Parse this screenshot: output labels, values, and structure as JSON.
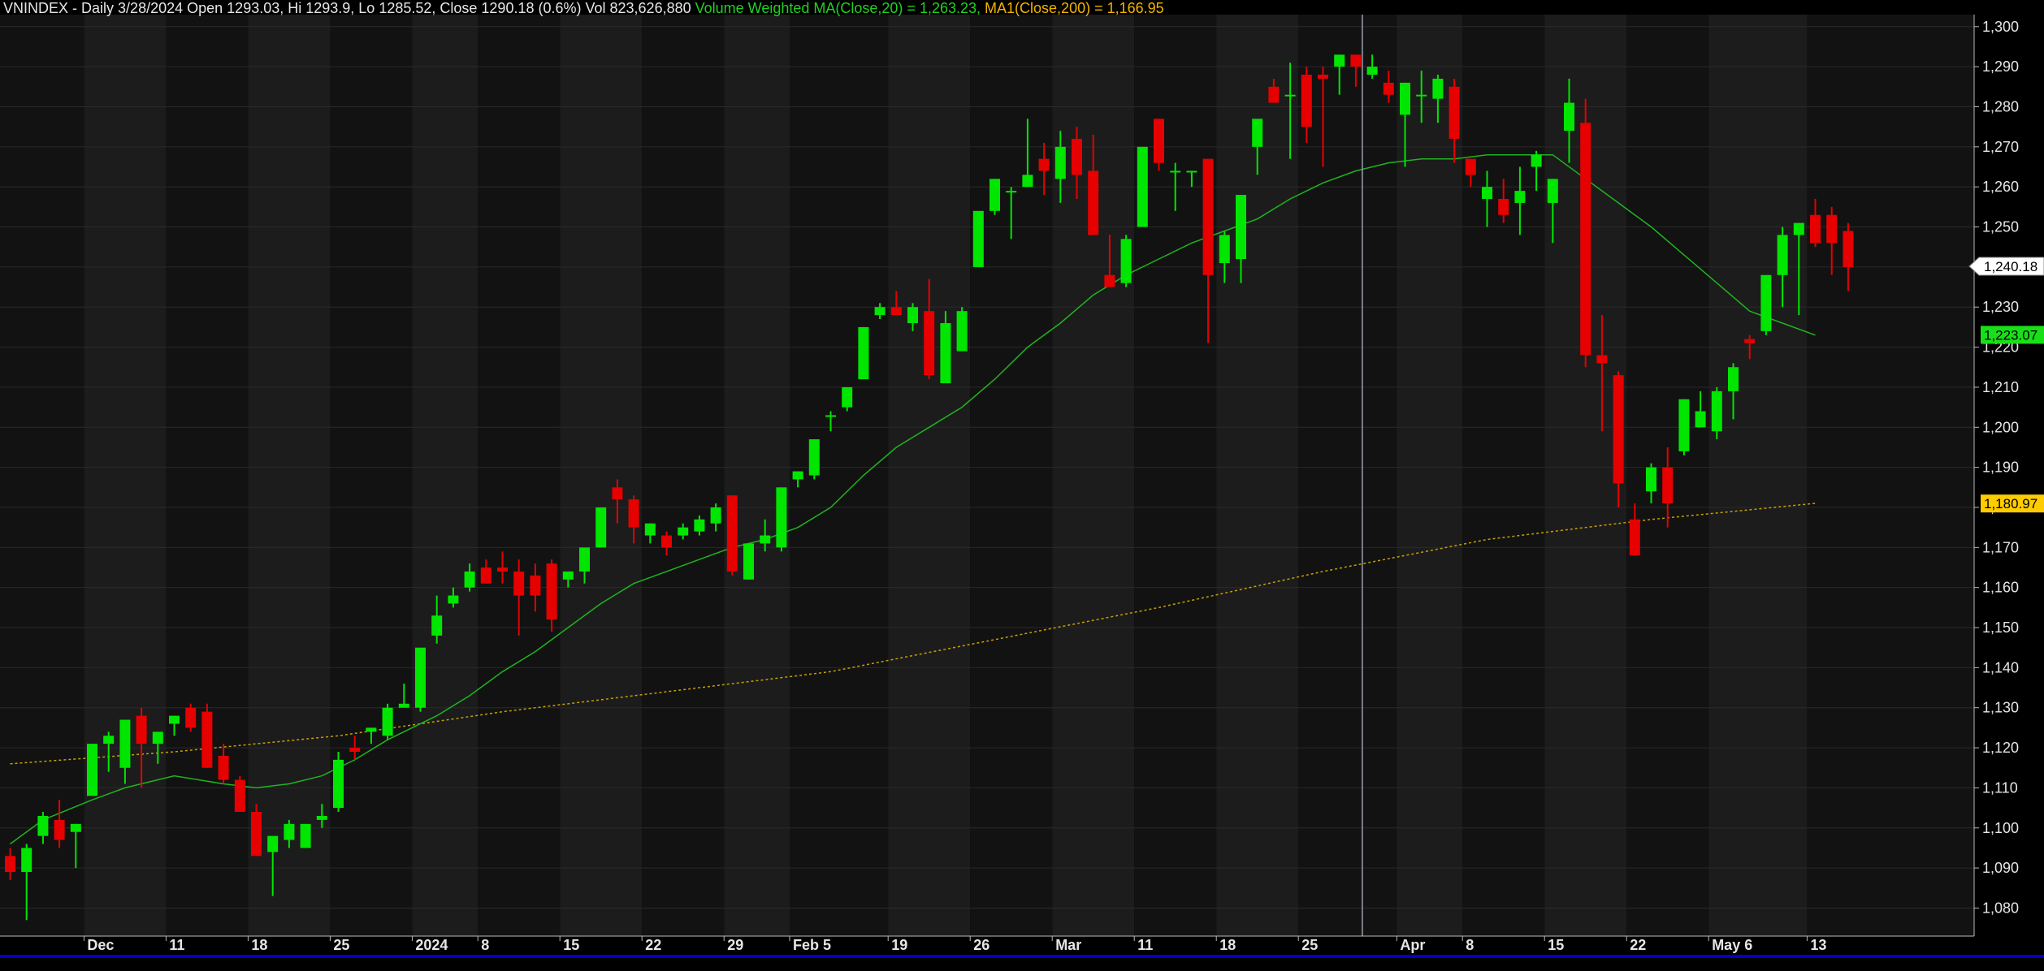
{
  "header": {
    "symbol": "VNINDEX",
    "period": "Daily",
    "date": "3/28/2024",
    "ohlcv_text": "Open 1293.03, Hi 1293.9, Lo 1285.52, Close 1290.18 (0.6%) Vol 823,626,880",
    "vwma_text": "Volume Weighted MA(Close,20) = 1,263.23,",
    "ma_text": "MA1(Close,200) = 1,166.95"
  },
  "colors": {
    "background": "#000000",
    "band_light": "#1c1c1c",
    "band_dark": "#121212",
    "up": "#00e600",
    "down": "#e60000",
    "vwma": "#1fb51f",
    "ma200": "#c8a000",
    "text": "#e6e6e6",
    "cursor": "#9aa0b0",
    "bottom_bar": "#0000c8"
  },
  "chart_data": {
    "type": "candlestick",
    "y_range": [
      1073,
      1303
    ],
    "y_ticks": [
      1080,
      1090,
      1100,
      1110,
      1120,
      1130,
      1140,
      1150,
      1160,
      1170,
      1180,
      1190,
      1200,
      1210,
      1220,
      1230,
      1240,
      1250,
      1260,
      1270,
      1280,
      1290,
      1300
    ],
    "y_tick_labels": [
      "1,080",
      "1,090",
      "1,100",
      "1,110",
      "1,120",
      "1,130",
      "1,140",
      "1,150",
      "1,160",
      "1,170",
      "1,180",
      "1,190",
      "1,200",
      "1,210",
      "1,220",
      "1,230",
      "1,240",
      "1,250",
      "1,260",
      "1,270",
      "1,280",
      "1,290",
      "1,300"
    ],
    "x_labels": [
      {
        "label": "Dec",
        "index": 5
      },
      {
        "label": "11",
        "index": 10
      },
      {
        "label": "18",
        "index": 15
      },
      {
        "label": "25",
        "index": 20
      },
      {
        "label": "2024",
        "index": 25
      },
      {
        "label": "8",
        "index": 29
      },
      {
        "label": "15",
        "index": 34
      },
      {
        "label": "22",
        "index": 39
      },
      {
        "label": "29",
        "index": 44
      },
      {
        "label": "Feb 5",
        "index": 48
      },
      {
        "label": "19",
        "index": 54
      },
      {
        "label": "26",
        "index": 59
      },
      {
        "label": "Mar",
        "index": 64
      },
      {
        "label": "11",
        "index": 69
      },
      {
        "label": "18",
        "index": 74
      },
      {
        "label": "25",
        "index": 79
      },
      {
        "label": "Apr",
        "index": 85
      },
      {
        "label": "8",
        "index": 89
      },
      {
        "label": "15",
        "index": 94
      },
      {
        "label": "22",
        "index": 99
      },
      {
        "label": "May 6",
        "index": 104
      },
      {
        "label": "13",
        "index": 110
      }
    ],
    "candles": [
      [
        1093,
        1095,
        1087,
        1089
      ],
      [
        1089,
        1096,
        1077,
        1095
      ],
      [
        1098,
        1104,
        1096,
        1103
      ],
      [
        1102,
        1107,
        1095,
        1097
      ],
      [
        1099,
        1101,
        1090,
        1101
      ],
      [
        1108,
        1115,
        1108,
        1121
      ],
      [
        1121,
        1124,
        1114,
        1123
      ],
      [
        1115,
        1127,
        1111,
        1127
      ],
      [
        1128,
        1130,
        1110,
        1121
      ],
      [
        1121,
        1123,
        1116,
        1124
      ],
      [
        1126,
        1128,
        1123,
        1128
      ],
      [
        1130,
        1131,
        1124,
        1125
      ],
      [
        1129,
        1131,
        1115,
        1115
      ],
      [
        1118,
        1121,
        1111,
        1112
      ],
      [
        1112,
        1113,
        1104,
        1104
      ],
      [
        1104,
        1106,
        1093,
        1093
      ],
      [
        1094,
        1097,
        1083,
        1098
      ],
      [
        1097,
        1102,
        1095,
        1101
      ],
      [
        1095,
        1098,
        1095,
        1101
      ],
      [
        1102,
        1106,
        1100,
        1103
      ],
      [
        1105,
        1119,
        1104,
        1117
      ],
      [
        1120,
        1123,
        1117,
        1119
      ],
      [
        1124,
        1125,
        1121,
        1125
      ],
      [
        1123,
        1131,
        1122,
        1130
      ],
      [
        1130,
        1136,
        1130,
        1131
      ],
      [
        1130,
        1143,
        1129,
        1145
      ],
      [
        1148,
        1158,
        1146,
        1153
      ],
      [
        1156,
        1160,
        1155,
        1158
      ],
      [
        1160,
        1166,
        1159,
        1164
      ],
      [
        1165,
        1167,
        1161,
        1161
      ],
      [
        1165,
        1169,
        1161,
        1164
      ],
      [
        1164,
        1167,
        1148,
        1158
      ],
      [
        1163,
        1166,
        1154,
        1158
      ],
      [
        1166,
        1167,
        1149,
        1152
      ],
      [
        1162,
        1164,
        1160,
        1164
      ],
      [
        1164,
        1167,
        1161,
        1170
      ],
      [
        1170,
        1180,
        1170,
        1180
      ],
      [
        1185,
        1187,
        1176,
        1182
      ],
      [
        1182,
        1183,
        1171,
        1175
      ],
      [
        1173,
        1176,
        1171,
        1176
      ],
      [
        1173,
        1174,
        1168,
        1170
      ],
      [
        1173,
        1176,
        1172,
        1175
      ],
      [
        1174,
        1178,
        1173,
        1177
      ],
      [
        1176,
        1181,
        1174,
        1180
      ],
      [
        1183,
        1183,
        1163,
        1164
      ],
      [
        1162,
        1170,
        1162,
        1171
      ],
      [
        1171,
        1177,
        1169,
        1173
      ],
      [
        1170,
        1184,
        1169,
        1185
      ],
      [
        1187,
        1189,
        1185,
        1189
      ],
      [
        1188,
        1197,
        1187,
        1197
      ],
      [
        1203,
        1204,
        1199,
        1203
      ],
      [
        1205,
        1210,
        1204,
        1210
      ],
      [
        1212,
        1225,
        1212,
        1225
      ],
      [
        1228,
        1231,
        1227,
        1230
      ],
      [
        1230,
        1234,
        1228,
        1228
      ],
      [
        1226,
        1231,
        1224,
        1230
      ],
      [
        1229,
        1237,
        1212,
        1213
      ],
      [
        1211,
        1229,
        1211,
        1226
      ],
      [
        1219,
        1230,
        1219,
        1229
      ],
      [
        1240,
        1253,
        1240,
        1254
      ],
      [
        1254,
        1262,
        1253,
        1262
      ],
      [
        1259,
        1260,
        1247,
        1259
      ],
      [
        1260,
        1277,
        1260,
        1263
      ],
      [
        1267,
        1271,
        1258,
        1264
      ],
      [
        1262,
        1274,
        1256,
        1270
      ],
      [
        1272,
        1275,
        1257,
        1263
      ],
      [
        1264,
        1273,
        1248,
        1248
      ],
      [
        1238,
        1248,
        1235,
        1235
      ],
      [
        1236,
        1248,
        1235,
        1247
      ],
      [
        1250,
        1270,
        1250,
        1270
      ],
      [
        1277,
        1277,
        1264,
        1266
      ],
      [
        1264,
        1266,
        1254,
        1264
      ],
      [
        1264,
        1264,
        1260,
        1264
      ],
      [
        1267,
        1267,
        1221,
        1238
      ],
      [
        1241,
        1249,
        1236,
        1248
      ],
      [
        1242,
        1252,
        1236,
        1258
      ],
      [
        1270,
        1273,
        1263,
        1277
      ],
      [
        1285,
        1287,
        1281,
        1281
      ],
      [
        1283,
        1291,
        1267,
        1283
      ],
      [
        1288,
        1290,
        1271,
        1275
      ],
      [
        1288,
        1290,
        1265,
        1287
      ],
      [
        1290,
        1293,
        1283,
        1293
      ],
      [
        1293,
        1293,
        1285,
        1290
      ],
      [
        1288,
        1293,
        1287,
        1290
      ],
      [
        1286,
        1289,
        1281,
        1283
      ],
      [
        1278,
        1286,
        1265,
        1286
      ],
      [
        1283,
        1289,
        1276,
        1283
      ],
      [
        1282,
        1288,
        1276,
        1287
      ],
      [
        1285,
        1287,
        1266,
        1272
      ],
      [
        1267,
        1267,
        1260,
        1263
      ],
      [
        1257,
        1264,
        1250,
        1260
      ],
      [
        1257,
        1262,
        1251,
        1253
      ],
      [
        1256,
        1265,
        1248,
        1259
      ],
      [
        1265,
        1269,
        1259,
        1268
      ],
      [
        1256,
        1262,
        1246,
        1262
      ],
      [
        1274,
        1287,
        1266,
        1281
      ],
      [
        1276,
        1282,
        1215,
        1218
      ],
      [
        1218,
        1228,
        1199,
        1216
      ],
      [
        1213,
        1214,
        1180,
        1186
      ],
      [
        1177,
        1181,
        1169,
        1168
      ],
      [
        1184,
        1191,
        1181,
        1190
      ],
      [
        1190,
        1195,
        1175,
        1181
      ],
      [
        1194,
        1207,
        1193,
        1207
      ],
      [
        1200,
        1209,
        1200,
        1204
      ],
      [
        1199,
        1210,
        1197,
        1209
      ],
      [
        1209,
        1216,
        1202,
        1215
      ],
      [
        1222,
        1223,
        1217,
        1221
      ],
      [
        1224,
        1230,
        1223,
        1238
      ],
      [
        1238,
        1250,
        1230,
        1248
      ],
      [
        1248,
        1251,
        1228,
        1251
      ],
      [
        1253,
        1257,
        1245,
        1246
      ],
      [
        1253,
        1255,
        1238,
        1246
      ],
      [
        1249,
        1251,
        1234,
        1240
      ]
    ],
    "vwma": [
      {
        "i": 0,
        "v": 1096
      },
      {
        "i": 2,
        "v": 1102
      },
      {
        "i": 5,
        "v": 1107
      },
      {
        "i": 7,
        "v": 1110
      },
      {
        "i": 9,
        "v": 1112
      },
      {
        "i": 10,
        "v": 1113
      },
      {
        "i": 13,
        "v": 1111
      },
      {
        "i": 15,
        "v": 1110
      },
      {
        "i": 17,
        "v": 1111
      },
      {
        "i": 19,
        "v": 1113
      },
      {
        "i": 21,
        "v": 1117
      },
      {
        "i": 23,
        "v": 1122
      },
      {
        "i": 24,
        "v": 1124
      },
      {
        "i": 26,
        "v": 1128
      },
      {
        "i": 28,
        "v": 1133
      },
      {
        "i": 30,
        "v": 1139
      },
      {
        "i": 32,
        "v": 1144
      },
      {
        "i": 34,
        "v": 1150
      },
      {
        "i": 36,
        "v": 1156
      },
      {
        "i": 38,
        "v": 1161
      },
      {
        "i": 40,
        "v": 1164
      },
      {
        "i": 42,
        "v": 1167
      },
      {
        "i": 44,
        "v": 1170
      },
      {
        "i": 46,
        "v": 1172
      },
      {
        "i": 48,
        "v": 1175
      },
      {
        "i": 50,
        "v": 1180
      },
      {
        "i": 52,
        "v": 1188
      },
      {
        "i": 54,
        "v": 1195
      },
      {
        "i": 56,
        "v": 1200
      },
      {
        "i": 58,
        "v": 1205
      },
      {
        "i": 60,
        "v": 1212
      },
      {
        "i": 62,
        "v": 1220
      },
      {
        "i": 64,
        "v": 1226
      },
      {
        "i": 66,
        "v": 1233
      },
      {
        "i": 68,
        "v": 1238
      },
      {
        "i": 70,
        "v": 1242
      },
      {
        "i": 72,
        "v": 1246
      },
      {
        "i": 74,
        "v": 1249
      },
      {
        "i": 76,
        "v": 1252
      },
      {
        "i": 78,
        "v": 1257
      },
      {
        "i": 80,
        "v": 1261
      },
      {
        "i": 82,
        "v": 1264
      },
      {
        "i": 84,
        "v": 1266
      },
      {
        "i": 86,
        "v": 1267
      },
      {
        "i": 88,
        "v": 1267
      },
      {
        "i": 90,
        "v": 1268
      },
      {
        "i": 92,
        "v": 1268
      },
      {
        "i": 94,
        "v": 1268
      },
      {
        "i": 96,
        "v": 1262
      },
      {
        "i": 98,
        "v": 1256
      },
      {
        "i": 100,
        "v": 1250
      },
      {
        "i": 102,
        "v": 1243
      },
      {
        "i": 104,
        "v": 1236
      },
      {
        "i": 106,
        "v": 1229
      },
      {
        "i": 108,
        "v": 1226
      },
      {
        "i": 110,
        "v": 1223
      }
    ],
    "ma200": [
      {
        "i": 0,
        "v": 1116
      },
      {
        "i": 10,
        "v": 1119
      },
      {
        "i": 20,
        "v": 1123
      },
      {
        "i": 30,
        "v": 1129
      },
      {
        "i": 40,
        "v": 1134
      },
      {
        "i": 50,
        "v": 1139
      },
      {
        "i": 60,
        "v": 1147
      },
      {
        "i": 70,
        "v": 1155
      },
      {
        "i": 80,
        "v": 1164
      },
      {
        "i": 90,
        "v": 1172
      },
      {
        "i": 100,
        "v": 1177
      },
      {
        "i": 110,
        "v": 1181
      }
    ],
    "price_tags": [
      {
        "label": "1,240.18",
        "value": 1240.18,
        "style": "white"
      },
      {
        "label": "1,223.07",
        "value": 1223.07,
        "style": "green"
      },
      {
        "label": "1,180.97",
        "value": 1180.97,
        "style": "yellow"
      }
    ],
    "cursor_index": 82
  }
}
